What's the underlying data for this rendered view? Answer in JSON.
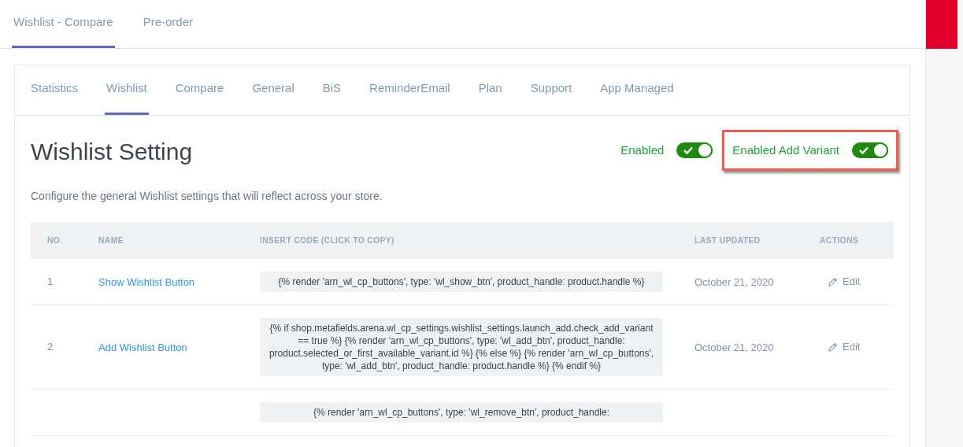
{
  "top_tabs": [
    {
      "label": "Wishlist - Compare",
      "selected": true
    },
    {
      "label": "Pre-order",
      "selected": false
    }
  ],
  "tabs": [
    {
      "label": "Statistics",
      "selected": false
    },
    {
      "label": "Wishlist",
      "selected": true
    },
    {
      "label": "Compare",
      "selected": false
    },
    {
      "label": "General",
      "selected": false
    },
    {
      "label": "BiS",
      "selected": false
    },
    {
      "label": "ReminderEmail",
      "selected": false
    },
    {
      "label": "Plan",
      "selected": false
    },
    {
      "label": "Support",
      "selected": false
    },
    {
      "label": "App Managed",
      "selected": false
    }
  ],
  "title": "Wishlist Setting",
  "toggles": [
    {
      "label": "Enabled",
      "on": true,
      "highlighted": false
    },
    {
      "label": "Enabled Add Variant",
      "on": true,
      "highlighted": true
    }
  ],
  "description": "Configure the general Wishlist settings that will reflect across your store.",
  "table": {
    "columns": [
      "NO.",
      "NAME",
      "INSERT CODE (CLICK TO COPY)",
      "LAST UPDATED",
      "ACTIONS"
    ],
    "rows": [
      {
        "no": "1",
        "name": "Show Wishlist Button",
        "code": "{% render 'arn_wl_cp_buttons', type: 'wl_show_btn', product_handle: product.handle %}",
        "updated": "October 21, 2020",
        "action": "Edit"
      },
      {
        "no": "2",
        "name": "Add Wishlist Button",
        "code": "{% if shop.metafields.arena.wl_cp_settings.wishlist_settings.launch_add.check_add_variant == true %} {% render 'arn_wl_cp_buttons', type: 'wl_add_btn', product_handle: product.selected_or_first_available_variant.id %} {% else %} {% render 'arn_wl_cp_buttons', type: 'wl_add_btn', product_handle: product.handle %} {% endif %}",
        "updated": "October 21, 2020",
        "action": "Edit"
      },
      {
        "code": "{% render 'arn_wl_cp_buttons', type: 'wl_remove_btn', product_handle:"
      }
    ]
  }
}
